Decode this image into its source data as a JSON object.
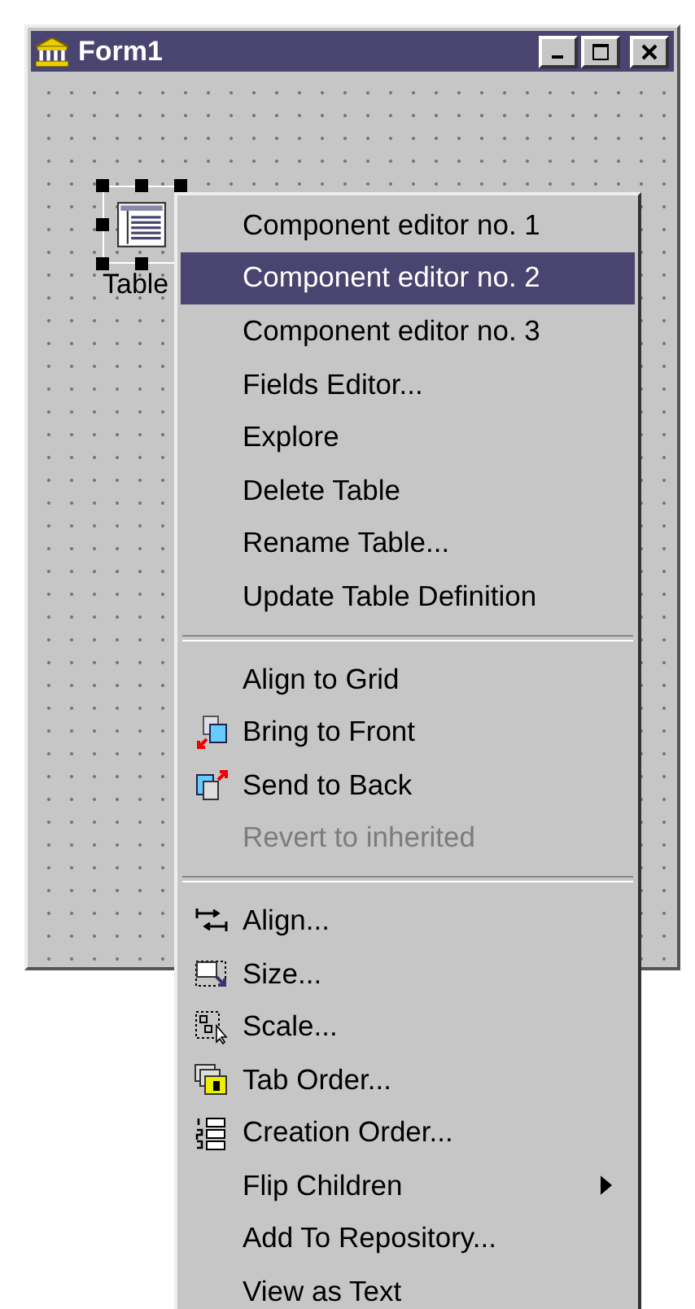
{
  "window": {
    "title": "Form1"
  },
  "component": {
    "label": "Table",
    "selected": true
  },
  "context_menu": {
    "sections": [
      [
        {
          "label": "Component editor no. 1",
          "selected": false,
          "disabled": false,
          "submenu": false
        },
        {
          "label": "Component editor no. 2",
          "selected": true,
          "disabled": false,
          "submenu": false
        },
        {
          "label": "Component editor no. 3",
          "selected": false,
          "disabled": false,
          "submenu": false
        },
        {
          "label": "Fields Editor...",
          "selected": false,
          "disabled": false,
          "submenu": false
        },
        {
          "label": "Explore",
          "selected": false,
          "disabled": false,
          "submenu": false
        },
        {
          "label": "Delete Table",
          "selected": false,
          "disabled": false,
          "submenu": false
        },
        {
          "label": "Rename Table...",
          "selected": false,
          "disabled": false,
          "submenu": false
        },
        {
          "label": "Update Table Definition",
          "selected": false,
          "disabled": false,
          "submenu": false
        }
      ],
      [
        {
          "label": "Align to Grid",
          "selected": false,
          "disabled": false,
          "submenu": false
        },
        {
          "label": "Bring to Front",
          "selected": false,
          "disabled": false,
          "submenu": false
        },
        {
          "label": "Send to Back",
          "selected": false,
          "disabled": false,
          "submenu": false
        },
        {
          "label": "Revert to inherited",
          "selected": false,
          "disabled": true,
          "submenu": false
        }
      ],
      [
        {
          "label": "Align...",
          "selected": false,
          "disabled": false,
          "submenu": false
        },
        {
          "label": "Size...",
          "selected": false,
          "disabled": false,
          "submenu": false
        },
        {
          "label": "Scale...",
          "selected": false,
          "disabled": false,
          "submenu": false
        },
        {
          "label": "Tab Order...",
          "selected": false,
          "disabled": false,
          "submenu": false
        },
        {
          "label": "Creation Order...",
          "selected": false,
          "disabled": false,
          "submenu": false
        },
        {
          "label": "Flip Children",
          "selected": false,
          "disabled": false,
          "submenu": true
        },
        {
          "label": "Add To Repository...",
          "selected": false,
          "disabled": false,
          "submenu": false
        },
        {
          "label": "View as Text",
          "selected": false,
          "disabled": false,
          "submenu": false
        }
      ]
    ]
  }
}
